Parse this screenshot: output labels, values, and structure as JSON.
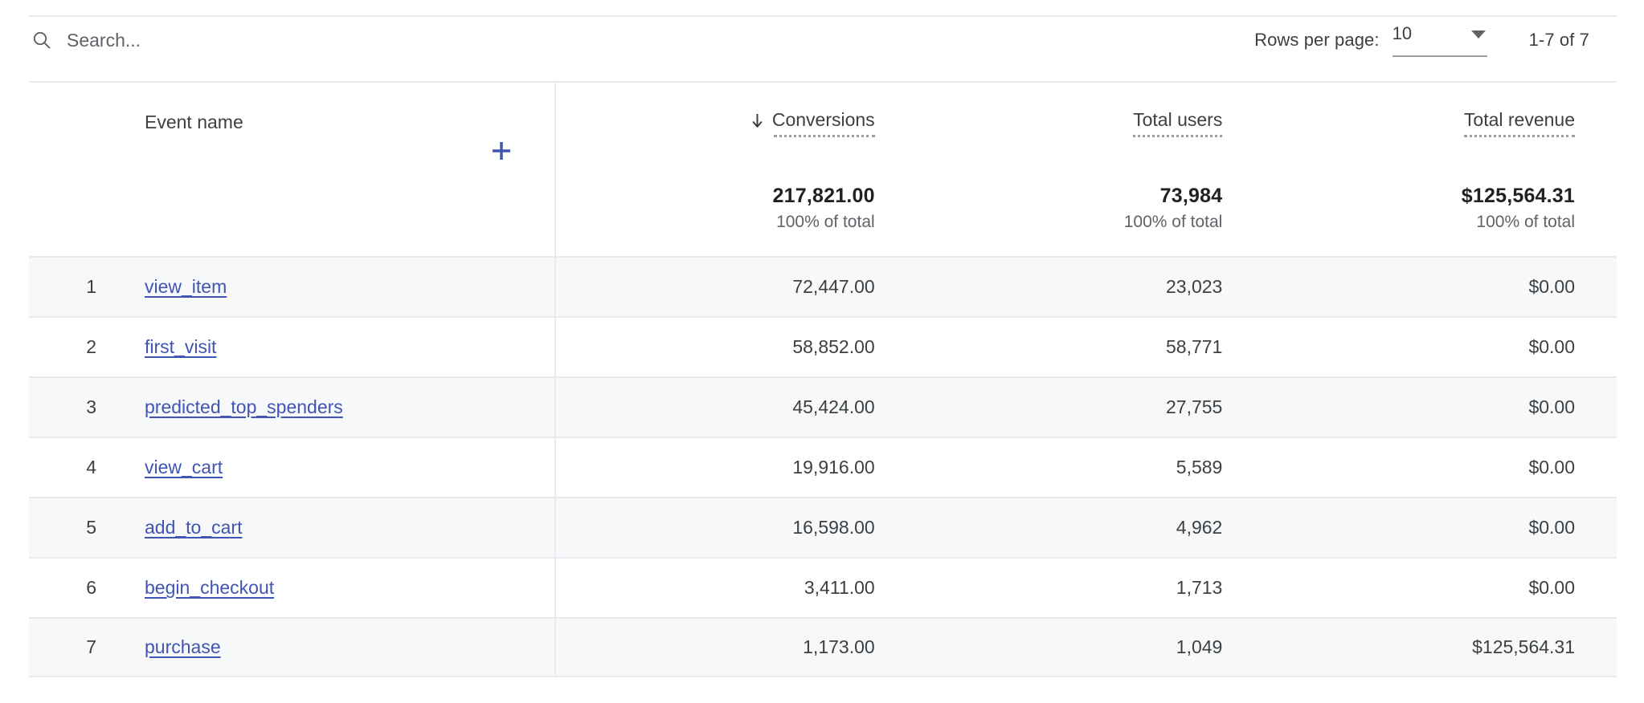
{
  "search": {
    "placeholder": "Search...",
    "value": "",
    "icon": "search-icon"
  },
  "pagination": {
    "rows_per_page_label": "Rows per page:",
    "rows_per_page_value": "10",
    "range_label": "1-7 of 7",
    "caret_icon": "chevron-down-icon"
  },
  "table": {
    "dimension_header": "Event name",
    "add_column_icon": "plus-icon",
    "sort_icon": "arrow-down-icon",
    "columns": [
      {
        "label": "Conversions",
        "sorted": true
      },
      {
        "label": "Total users",
        "sorted": false
      },
      {
        "label": "Total revenue",
        "sorted": false
      }
    ],
    "totals": [
      {
        "value": "217,821.00",
        "sub": "100% of total"
      },
      {
        "value": "73,984",
        "sub": "100% of total"
      },
      {
        "value": "$125,564.31",
        "sub": "100% of total"
      }
    ],
    "rows": [
      {
        "index": "1",
        "name": "view_item",
        "conversions": "72,447.00",
        "total_users": "23,023",
        "total_revenue": "$0.00"
      },
      {
        "index": "2",
        "name": "first_visit",
        "conversions": "58,852.00",
        "total_users": "58,771",
        "total_revenue": "$0.00"
      },
      {
        "index": "3",
        "name": "predicted_top_spenders",
        "conversions": "45,424.00",
        "total_users": "27,755",
        "total_revenue": "$0.00"
      },
      {
        "index": "4",
        "name": "view_cart",
        "conversions": "19,916.00",
        "total_users": "5,589",
        "total_revenue": "$0.00"
      },
      {
        "index": "5",
        "name": "add_to_cart",
        "conversions": "16,598.00",
        "total_users": "4,962",
        "total_revenue": "$0.00"
      },
      {
        "index": "6",
        "name": "begin_checkout",
        "conversions": "3,411.00",
        "total_users": "1,713",
        "total_revenue": "$0.00"
      },
      {
        "index": "7",
        "name": "purchase",
        "conversions": "1,173.00",
        "total_users": "1,049",
        "total_revenue": "$125,564.31"
      }
    ]
  },
  "colors": {
    "link": "#4054b2",
    "accent": "#4054b2",
    "text": "#3c4043",
    "muted": "#5f6368",
    "border": "#e8eaed",
    "stripe": "#f7f8f9"
  }
}
